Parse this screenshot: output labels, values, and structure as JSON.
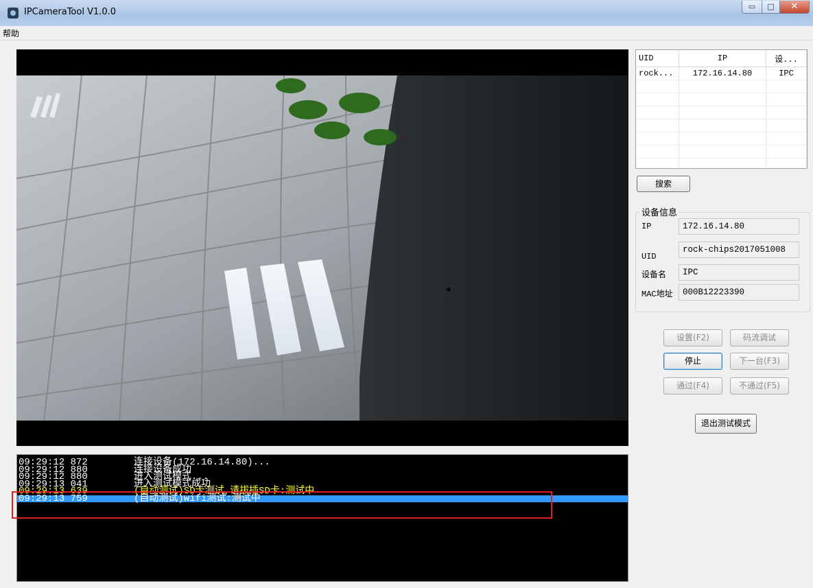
{
  "window": {
    "title": "IPCameraTool V1.0.0",
    "min_glyph": "▭",
    "max_glyph": "□",
    "close_glyph": "✕"
  },
  "menu": {
    "help": "帮助"
  },
  "device_list": {
    "columns": [
      "UID",
      "IP",
      "设..."
    ],
    "rows": [
      [
        "rock...",
        "172.16.14.80",
        "IPC"
      ]
    ]
  },
  "search_button": "搜索",
  "device_info": {
    "group_title": "设备信息",
    "ip_label": "IP",
    "ip_value": "172.16.14.80",
    "uid_label": "UID",
    "uid_value": "rock-chips2017051008",
    "name_label": "设备名",
    "name_value": "IPC",
    "mac_label": "MAC地址",
    "mac_value": "000B12223390"
  },
  "buttons": {
    "settings": "设置(F2)",
    "stream_debug": "码流调试",
    "stop": "停止",
    "next": "下一台(F3)",
    "pass": "通过(F4)",
    "fail": "不通过(F5)",
    "exit_test": "退出测试模式"
  },
  "log": [
    {
      "time": "09:29:12 872",
      "msg": "连接设备(172.16.14.80)...",
      "style": "normal"
    },
    {
      "time": "09:29:12 880",
      "msg": "连接设备成功",
      "style": "normal"
    },
    {
      "time": "09:29:12 880",
      "msg": "进入测试模式...",
      "style": "normal"
    },
    {
      "time": "09:29:13 041",
      "msg": "进入测试模式成功",
      "style": "normal"
    },
    {
      "time": "09:29:13 639",
      "msg": "(自动测试)SD卡测试,请拔插SD卡:测试中",
      "style": "yellow"
    },
    {
      "time": "09:29:13 759",
      "msg": "(自动测试)wifi测试:测试中",
      "style": "selected"
    }
  ],
  "colors": {
    "log_bg": "#000000",
    "log_highlight": "#3399ff",
    "log_warning": "#ffff33",
    "annotation_box": "#e02020"
  }
}
